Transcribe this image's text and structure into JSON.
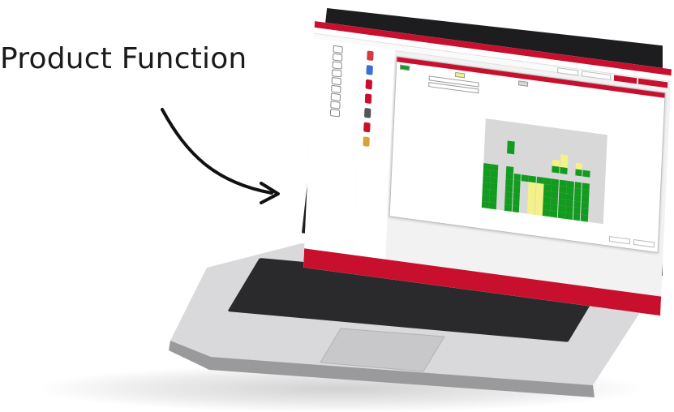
{
  "headline": "Product Function",
  "app": {
    "title_bar": "",
    "menu": [],
    "toolbar_buttons": [],
    "sidebar_sections": [],
    "dialog": {
      "title": "",
      "legend": [],
      "buttons": []
    }
  },
  "colors": {
    "brand_red": "#c8102e",
    "grid_green": "#129b1f",
    "grid_yellow": "#f4f287",
    "grid_gray": "#d8d8d8"
  }
}
